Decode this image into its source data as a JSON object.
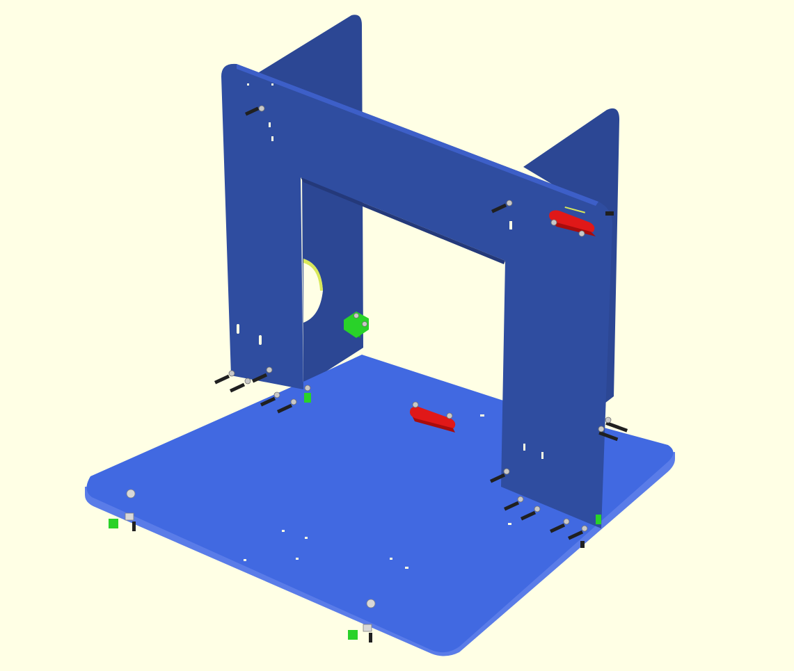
{
  "viewer": {
    "background_color": "#ffffe5",
    "base_plate_color": "#4169e1",
    "frame_color": "#2c4794",
    "bracket_color": "#e01818",
    "clip_color": "#29d229",
    "bolt_color": "#202020"
  }
}
